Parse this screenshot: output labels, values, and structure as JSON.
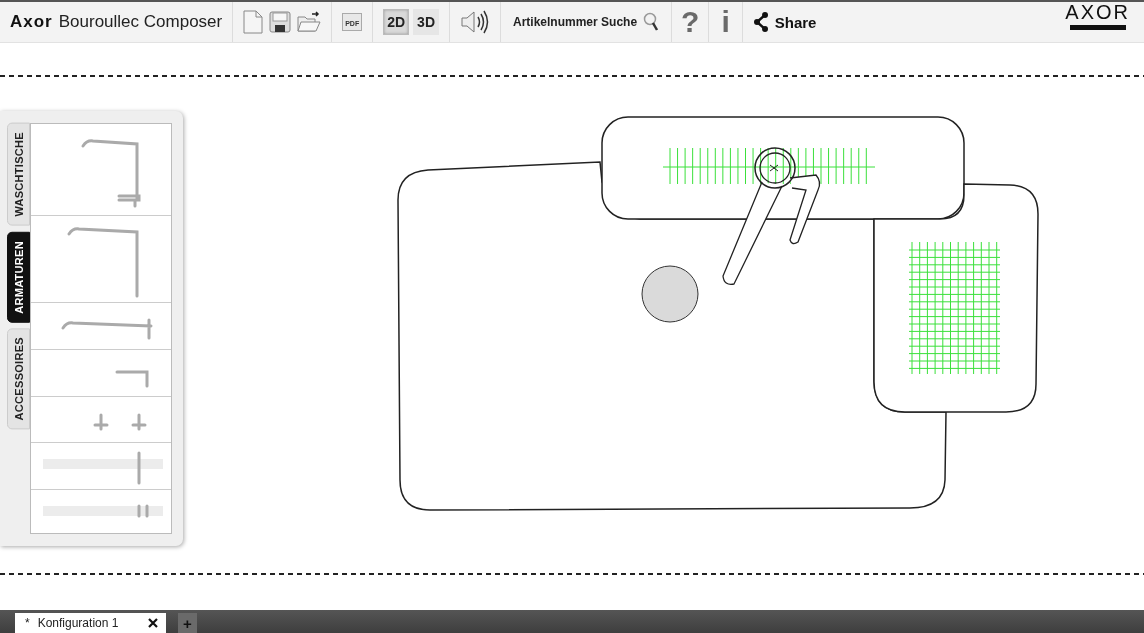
{
  "toolbar": {
    "brand": "Axor",
    "title": "Bouroullec Composer",
    "pdf_label": "PDF",
    "view_modes": [
      {
        "label": "2D",
        "selected": true
      },
      {
        "label": "3D",
        "selected": false
      }
    ],
    "search_label": "Artikelnummer Suche",
    "help_glyph": "?",
    "info_glyph": "i",
    "share_label": "Share",
    "logo": "AXOR"
  },
  "sidebar": {
    "tabs": [
      {
        "label": "WASCHTISCHE",
        "selected": false
      },
      {
        "label": "ARMATUREN",
        "selected": true
      },
      {
        "label": "ACCESSOIRES",
        "selected": false
      }
    ],
    "products": [
      {
        "kind": "basin-mixer"
      },
      {
        "kind": "tall-spout"
      },
      {
        "kind": "long-spout"
      },
      {
        "kind": "short-spout"
      },
      {
        "kind": "handles"
      },
      {
        "kind": "panel-lever"
      },
      {
        "kind": "panel-handles"
      }
    ]
  },
  "document_tabs": [
    {
      "marker": "*",
      "label": "Konfiguration 1",
      "selected": true
    }
  ],
  "add_tab": "+"
}
